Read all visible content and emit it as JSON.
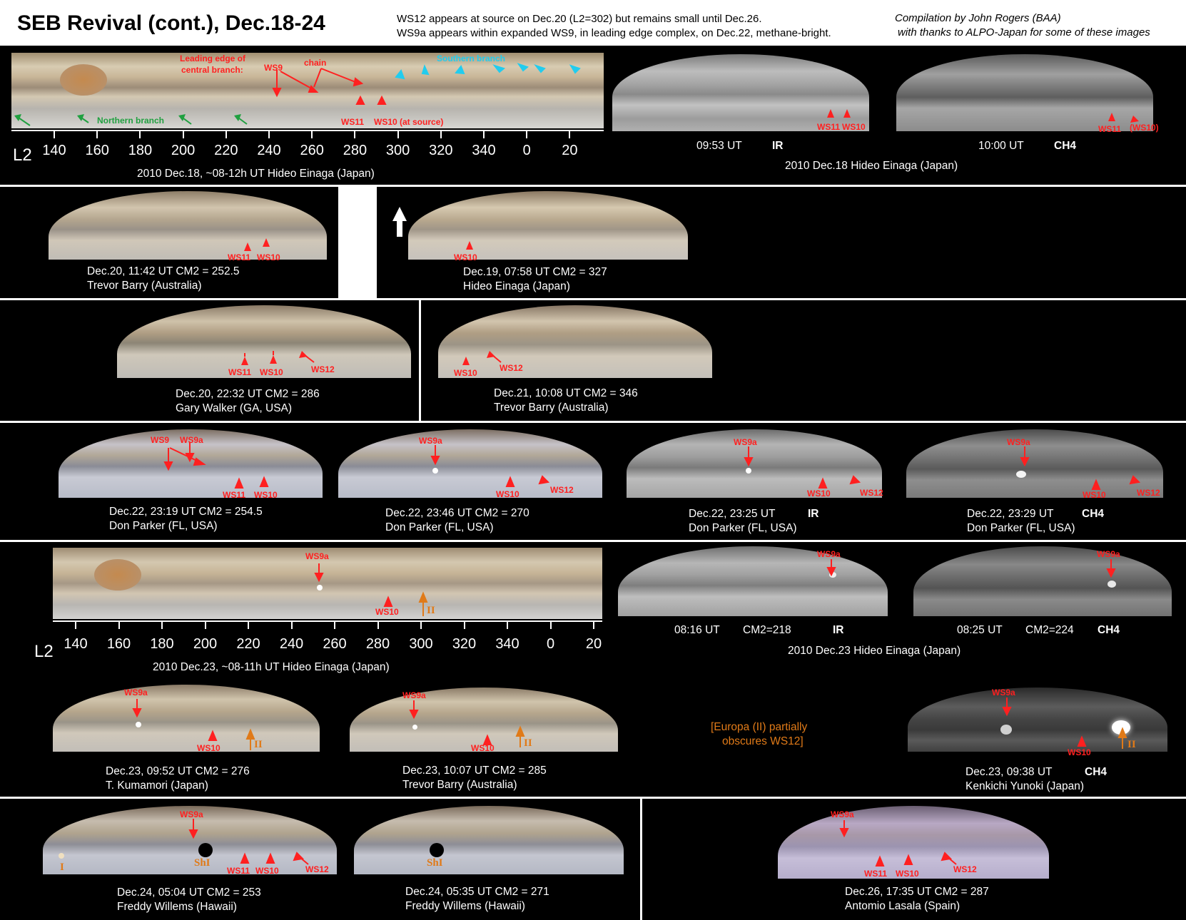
{
  "header": {
    "title": "SEB Revival (cont.), Dec.18-24",
    "note1": "WS12 appears at source on Dec.20 (L2=302) but remains small until Dec.26.",
    "note2": "WS9a appears within expanded WS9, in leading edge complex, on Dec.22, methane-bright.",
    "credit1": "Compilation by John Rogers (BAA)",
    "credit2": "with thanks to ALPO-Japan for some of these images"
  },
  "colors": {
    "red": "#ff2020",
    "cyan": "#22ccee",
    "green": "#20a040",
    "orange": "#e07a18"
  },
  "scale": {
    "prefix": "L2",
    "ticks": [
      "140",
      "160",
      "180",
      "200",
      "220",
      "240",
      "260",
      "280",
      "300",
      "320",
      "340",
      "0",
      "20"
    ]
  },
  "row1": {
    "map": {
      "caption": "2010 Dec.18, ~08-12h UT      Hideo Einaga (Japan)",
      "labels": {
        "leading1": "Leading edge of",
        "leading2": "central branch:",
        "ws9": "WS9",
        "chain": "chain",
        "southern": "Southern branch",
        "northern": "Northern branch",
        "ws11": "WS11",
        "ws10": "WS10 (at source)"
      }
    },
    "ir": {
      "time": "09:53 UT",
      "band": "IR",
      "ws11": "WS11",
      "ws10": "WS10"
    },
    "ch4": {
      "time": "10:00 UT",
      "band": "CH4",
      "ws11": "WS11",
      "ws10": "(WS10)"
    },
    "caption": "2010 Dec.18      Hideo Einaga (Japan)"
  },
  "row2": {
    "a": {
      "line1": "Dec.20, 11:42 UT    CM2 = 252.5",
      "line2": "Trevor Barry (Australia)",
      "ws11": "WS11",
      "ws10": "WS10"
    },
    "b": {
      "line1": "Dec.19, 07:58 UT    CM2 = 327",
      "line2": "Hideo Einaga (Japan)",
      "ws10": "WS10"
    }
  },
  "row3": {
    "a": {
      "line1": "Dec.20, 22:32 UT    CM2 = 286",
      "line2": "Gary Walker (GA, USA)",
      "ws11": "WS11",
      "ws10": "WS10",
      "ws12": "WS12"
    },
    "b": {
      "line1": "Dec.21, 10:08 UT    CM2 = 346",
      "line2": "Trevor Barry (Australia)",
      "ws10": "WS10",
      "ws12": "WS12"
    }
  },
  "row4": {
    "a": {
      "line1": "Dec.22, 23:19 UT    CM2 = 254.5",
      "line2": "Don Parker (FL, USA)",
      "ws9": "WS9",
      "ws9a": "WS9a",
      "ws11": "WS11",
      "ws10": "WS10"
    },
    "b": {
      "line1": "Dec.22, 23:46 UT    CM2 = 270",
      "line2": "Don Parker (FL, USA)",
      "ws9a": "WS9a",
      "ws10": "WS10",
      "ws12": "WS12"
    },
    "c": {
      "line1": "Dec.22, 23:25 UT",
      "band": "IR",
      "line2": "Don Parker (FL, USA)",
      "ws9a": "WS9a",
      "ws10": "WS10",
      "ws12": "WS12"
    },
    "d": {
      "line1": "Dec.22, 23:29 UT",
      "band": "CH4",
      "line2": "Don Parker (FL, USA)",
      "ws9a": "WS9a",
      "ws10": "WS10",
      "ws12": "WS12"
    }
  },
  "row5": {
    "map": {
      "caption": "2010 Dec.23, ~08-11h UT      Hideo Einaga (Japan)",
      "ws9a": "WS9a",
      "ws10": "WS10",
      "moon": "II"
    },
    "ir": {
      "time": "08:16 UT",
      "cm": "CM2=218",
      "band": "IR",
      "ws9a": "WS9a"
    },
    "ch4": {
      "time": "08:25 UT",
      "cm": "CM2=224",
      "band": "CH4",
      "ws9a": "WS9a"
    },
    "caption": "2010 Dec.23      Hideo Einaga (Japan)"
  },
  "row6": {
    "a": {
      "line1": "Dec.23, 09:52 UT    CM2 = 276",
      "line2": "T. Kumamori (Japan)",
      "ws9a": "WS9a",
      "ws10": "WS10",
      "moon": "II"
    },
    "b": {
      "line1": "Dec.23, 10:07 UT    CM2 = 285",
      "line2": "Trevor Barry (Australia)",
      "ws9a": "WS9a",
      "ws10": "WS10",
      "moon": "II"
    },
    "note1": "[Europa (II) partially",
    "note2": "obscures WS12]",
    "c": {
      "line1": "Dec.23, 09:38 UT",
      "band": "CH4",
      "line2": "Kenkichi Yunoki (Japan)",
      "ws9a": "WS9a",
      "ws10": "WS10",
      "moon": "II"
    }
  },
  "row7": {
    "a": {
      "line1": "Dec.24, 05:04 UT    CM2 = 253",
      "line2": "Freddy Willems (Hawaii)",
      "ws9a": "WS9a",
      "ws11": "WS11",
      "ws10": "WS10",
      "ws12": "WS12",
      "shadow": "ShI",
      "moon": "I"
    },
    "b": {
      "line1": "Dec.24, 05:35 UT    CM2 = 271",
      "line2": "Freddy Willems (Hawaii)",
      "shadow": "ShI"
    },
    "c": {
      "line1": "Dec.26, 17:35 UT    CM2 = 287",
      "line2": "Antomio Lasala (Spain)",
      "ws9a": "WS9a",
      "ws11": "WS11",
      "ws10": "WS10",
      "ws12": "WS12"
    }
  }
}
